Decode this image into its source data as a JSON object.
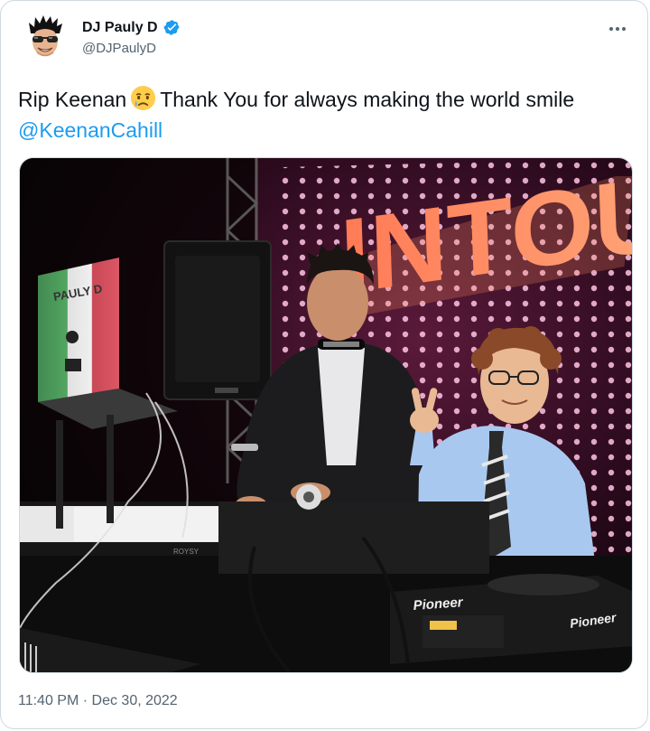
{
  "author": {
    "display_name": "DJ Pauly D",
    "handle": "@DJPaulyD",
    "verified": true
  },
  "tweet": {
    "text_before_emoji": "Rip Keenan",
    "emoji": "crying-face-emoji",
    "text_after_emoji": "Thank You for always making the world smile",
    "mention": "@KeenanCahill",
    "timestamp": "11:40 PM · Dec 30, 2022"
  },
  "media": {
    "sign_text": "INTOUC",
    "laptop_sticker_text": "PAULY D",
    "pioneer_brand_1": "Pioneer",
    "pioneer_brand_2": "Pioneer",
    "mixer_brand": "ROYSY"
  },
  "colors": {
    "link": "#1d9bf0",
    "secondary_text": "#536471",
    "border": "#cfd9de",
    "verified_badge": "#1d9bf0"
  }
}
